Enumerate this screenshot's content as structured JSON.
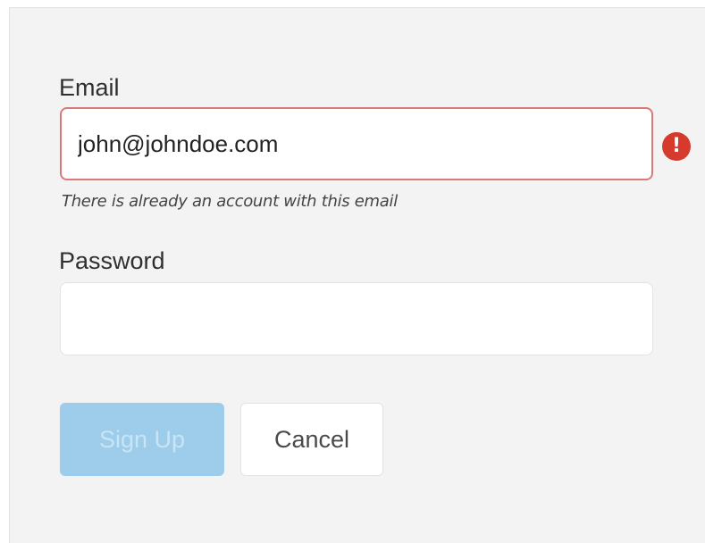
{
  "form": {
    "email": {
      "label": "Email",
      "value": "john@johndoe.com",
      "error": "There is already an account with this email",
      "error_color": "#d63a2d"
    },
    "password": {
      "label": "Password",
      "value": ""
    },
    "buttons": {
      "signup_label": "Sign Up",
      "cancel_label": "Cancel"
    }
  },
  "icons": {
    "error": "exclamation-circle-icon"
  }
}
